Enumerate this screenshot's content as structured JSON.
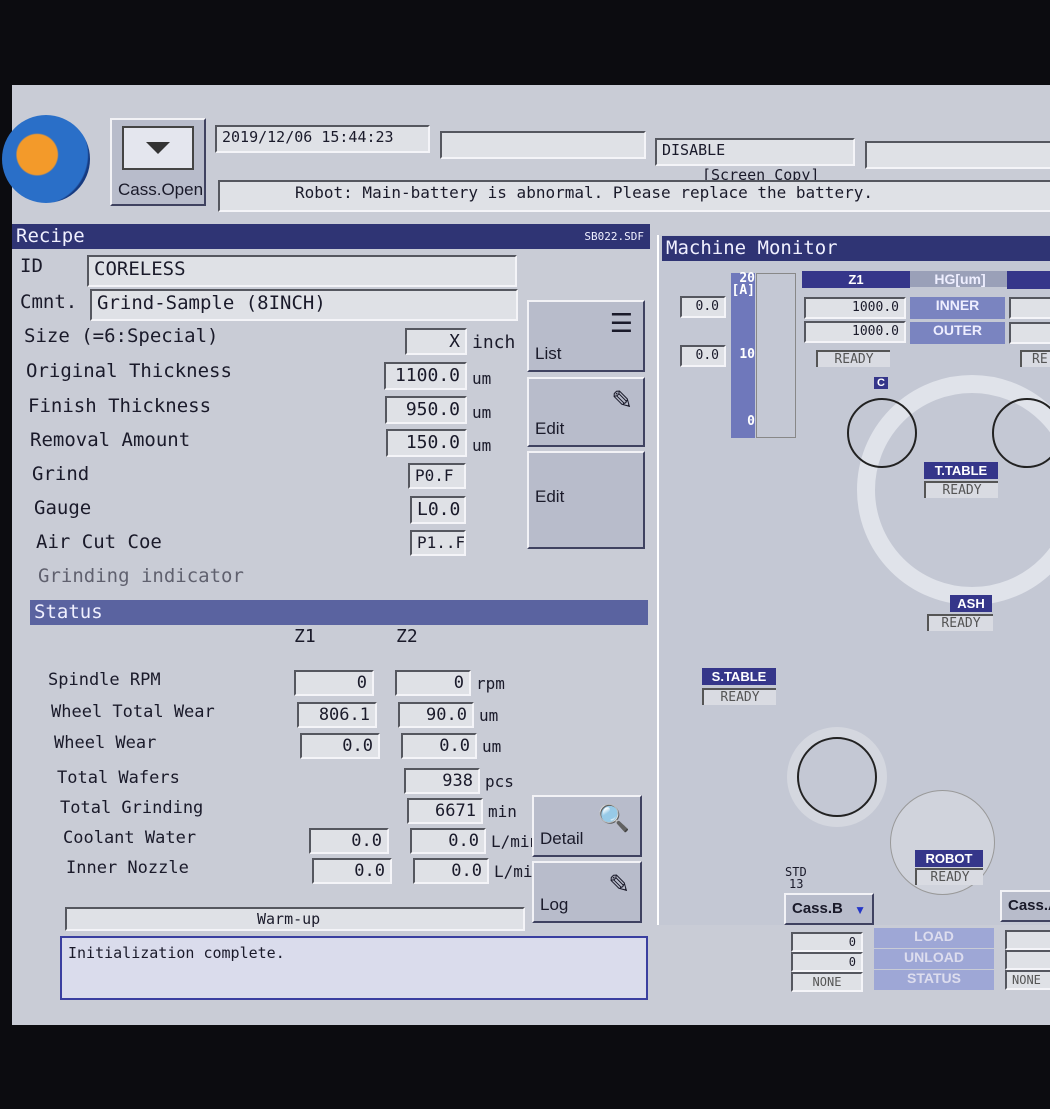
{
  "header": {
    "cass_open": "Cass.Open",
    "datetime": "2019/12/06 15:44:23",
    "mode": "DISABLE",
    "screen_copy": "[Screen Copy]",
    "message": "Robot: Main-battery is abnormal. Please replace the battery."
  },
  "recipe": {
    "title": "Recipe",
    "file": "SB022.SDF",
    "id_label": "ID",
    "id_value": "CORELESS",
    "cmnt_label": "Cmnt.",
    "cmnt_value": "Grind-Sample (8INCH)",
    "size_label": "Size  (=6:Special)",
    "size_value": "X",
    "size_unit": "inch",
    "orig_label": "Original Thickness",
    "orig_value": "1100.0",
    "orig_unit": "um",
    "finish_label": "Finish Thickness",
    "finish_value": "950.0",
    "finish_unit": "um",
    "removal_label": "Removal Amount",
    "removal_value": "150.0",
    "removal_unit": "um",
    "grind_label": "Grind",
    "grind_value": "P0.F",
    "gauge_label": "Gauge",
    "gauge_value": "L0.0",
    "aircut_label": "Air Cut Coe",
    "aircut_value": "P1..F",
    "grinding_label": "Grinding indicator",
    "buttons": {
      "list": "List",
      "edit1": "Edit",
      "edit2": "Edit"
    }
  },
  "status": {
    "title": "Status",
    "z1": "Z1",
    "z2": "Z2",
    "rows": [
      {
        "label": "Spindle RPM",
        "z1": "0",
        "z2": "0",
        "unit": "rpm"
      },
      {
        "label": "Wheel Total Wear",
        "z1": "806.1",
        "z2": "90.0",
        "unit": "um"
      },
      {
        "label": "Wheel Wear",
        "z1": "0.0",
        "z2": "0.0",
        "unit": "um"
      },
      {
        "label": "Total Wafers",
        "z1": "",
        "z2": "938",
        "unit": "pcs"
      },
      {
        "label": "Total Grinding",
        "z1": "",
        "z2": "6671",
        "unit": "min"
      },
      {
        "label": "Coolant Water",
        "z1": "0.0",
        "z2": "0.0",
        "unit": "L/min"
      },
      {
        "label": "Inner Nozzle",
        "z1": "0.0",
        "z2": "0.0",
        "unit": "L/min"
      }
    ],
    "warmup": "Warm-up",
    "detail": "Detail",
    "log": "Log",
    "message": "Initialization complete."
  },
  "monitor": {
    "title": "Machine Monitor",
    "amp_top": "20\n[A]",
    "amp_mid": "10",
    "amp_bot": "0",
    "amp1": "0.0",
    "amp2": "0.0",
    "z1": "Z1",
    "hg": "HG[um]",
    "inner": "INNER",
    "outer": "OUTER",
    "z1_inner": "1000.0",
    "z1_outer": "1000.0",
    "z1_state": "READY",
    "z2_state": "RE",
    "c": "C",
    "ttable": "T.TABLE",
    "ttable_state": "READY",
    "wash": "ASH",
    "wash_state": "READY",
    "stable": "S.TABLE",
    "stable_state": "READY",
    "robot": "ROBOT",
    "robot_state": "READY",
    "std": "STD",
    "std_num": "13",
    "cassb": "Cass.B",
    "cassb_v1": "0",
    "cassb_v2": "0",
    "cassb_state": "NONE",
    "load": "LOAD",
    "unload": "UNLOAD",
    "statuslbl": "STATUS",
    "cassa": "Cass.A",
    "cassa_state": "NONE"
  },
  "colors": {
    "titlebar": "#2f3474",
    "tag": "#35368a",
    "screen": "#c9ccd6"
  }
}
